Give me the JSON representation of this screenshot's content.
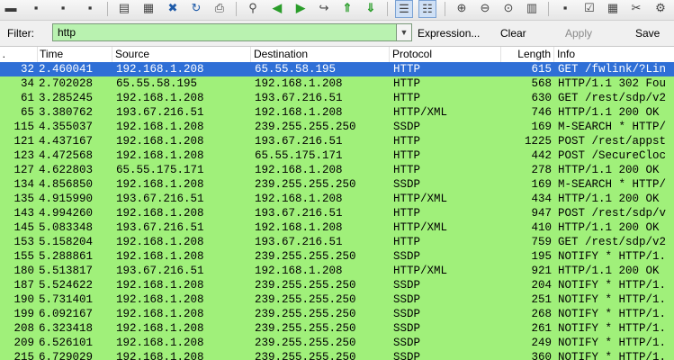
{
  "toolbar": {
    "icons": [
      "open-file",
      "save-file",
      "close-file",
      "reload",
      "print",
      "find-packet",
      "go-back",
      "go-forward",
      "go-to-packet",
      "go-first",
      "go-last",
      "colorize",
      "auto-scroll",
      "zoom-in",
      "zoom-out",
      "zoom-normal",
      "capture-filters",
      "display-filters",
      "preferences"
    ]
  },
  "filter": {
    "label": "Filter:",
    "value": "http",
    "expression_label": "Expression...",
    "clear_label": "Clear",
    "apply_label": "Apply",
    "save_label": "Save"
  },
  "columns": {
    "no": ".",
    "time": "Time",
    "source": "Source",
    "destination": "Destination",
    "protocol": "Protocol",
    "length": "Length",
    "info": "Info"
  },
  "colors": {
    "row_green": "#a0f07a",
    "selected_bg": "#2f6fd6",
    "selected_fg": "#ffffff",
    "filter_bg": "#b9f2b0"
  },
  "packets": [
    {
      "no": "32",
      "time": "2.460041",
      "src": "192.168.1.208",
      "dst": "65.55.58.195",
      "proto": "HTTP",
      "len": "615",
      "info": "GET /fwlink/?Lin",
      "selected": true
    },
    {
      "no": "34",
      "time": "2.702028",
      "src": "65.55.58.195",
      "dst": "192.168.1.208",
      "proto": "HTTP",
      "len": "568",
      "info": "HTTP/1.1 302 Fou"
    },
    {
      "no": "61",
      "time": "3.285245",
      "src": "192.168.1.208",
      "dst": "193.67.216.51",
      "proto": "HTTP",
      "len": "630",
      "info": "GET /rest/sdp/v2"
    },
    {
      "no": "65",
      "time": "3.380762",
      "src": "193.67.216.51",
      "dst": "192.168.1.208",
      "proto": "HTTP/XML",
      "len": "746",
      "info": "HTTP/1.1 200 OK"
    },
    {
      "no": "115",
      "time": "4.355037",
      "src": "192.168.1.208",
      "dst": "239.255.255.250",
      "proto": "SSDP",
      "len": "169",
      "info": "M-SEARCH * HTTP/"
    },
    {
      "no": "121",
      "time": "4.437167",
      "src": "192.168.1.208",
      "dst": "193.67.216.51",
      "proto": "HTTP",
      "len": "1225",
      "info": "POST /rest/appst"
    },
    {
      "no": "123",
      "time": "4.472568",
      "src": "192.168.1.208",
      "dst": "65.55.175.171",
      "proto": "HTTP",
      "len": "442",
      "info": "POST /SecureCloc"
    },
    {
      "no": "127",
      "time": "4.622803",
      "src": "65.55.175.171",
      "dst": "192.168.1.208",
      "proto": "HTTP",
      "len": "278",
      "info": "HTTP/1.1 200 OK"
    },
    {
      "no": "134",
      "time": "4.856850",
      "src": "192.168.1.208",
      "dst": "239.255.255.250",
      "proto": "SSDP",
      "len": "169",
      "info": "M-SEARCH * HTTP/"
    },
    {
      "no": "135",
      "time": "4.915990",
      "src": "193.67.216.51",
      "dst": "192.168.1.208",
      "proto": "HTTP/XML",
      "len": "434",
      "info": "HTTP/1.1 200 OK"
    },
    {
      "no": "143",
      "time": "4.994260",
      "src": "192.168.1.208",
      "dst": "193.67.216.51",
      "proto": "HTTP",
      "len": "947",
      "info": "POST /rest/sdp/v"
    },
    {
      "no": "145",
      "time": "5.083348",
      "src": "193.67.216.51",
      "dst": "192.168.1.208",
      "proto": "HTTP/XML",
      "len": "410",
      "info": "HTTP/1.1 200 OK"
    },
    {
      "no": "153",
      "time": "5.158204",
      "src": "192.168.1.208",
      "dst": "193.67.216.51",
      "proto": "HTTP",
      "len": "759",
      "info": "GET /rest/sdp/v2"
    },
    {
      "no": "155",
      "time": "5.288861",
      "src": "192.168.1.208",
      "dst": "239.255.255.250",
      "proto": "SSDP",
      "len": "195",
      "info": "NOTIFY * HTTP/1."
    },
    {
      "no": "180",
      "time": "5.513817",
      "src": "193.67.216.51",
      "dst": "192.168.1.208",
      "proto": "HTTP/XML",
      "len": "921",
      "info": "HTTP/1.1 200 OK"
    },
    {
      "no": "187",
      "time": "5.524622",
      "src": "192.168.1.208",
      "dst": "239.255.255.250",
      "proto": "SSDP",
      "len": "204",
      "info": "NOTIFY * HTTP/1."
    },
    {
      "no": "190",
      "time": "5.731401",
      "src": "192.168.1.208",
      "dst": "239.255.255.250",
      "proto": "SSDP",
      "len": "251",
      "info": "NOTIFY * HTTP/1."
    },
    {
      "no": "199",
      "time": "6.092167",
      "src": "192.168.1.208",
      "dst": "239.255.255.250",
      "proto": "SSDP",
      "len": "268",
      "info": "NOTIFY * HTTP/1."
    },
    {
      "no": "208",
      "time": "6.323418",
      "src": "192.168.1.208",
      "dst": "239.255.255.250",
      "proto": "SSDP",
      "len": "261",
      "info": "NOTIFY * HTTP/1."
    },
    {
      "no": "209",
      "time": "6.526101",
      "src": "192.168.1.208",
      "dst": "239.255.255.250",
      "proto": "SSDP",
      "len": "249",
      "info": "NOTIFY * HTTP/1."
    },
    {
      "no": "215",
      "time": "6.729029",
      "src": "192.168.1.208",
      "dst": "239.255.255.250",
      "proto": "SSDP",
      "len": "360",
      "info": "NOTIFY * HTTP/1."
    }
  ]
}
